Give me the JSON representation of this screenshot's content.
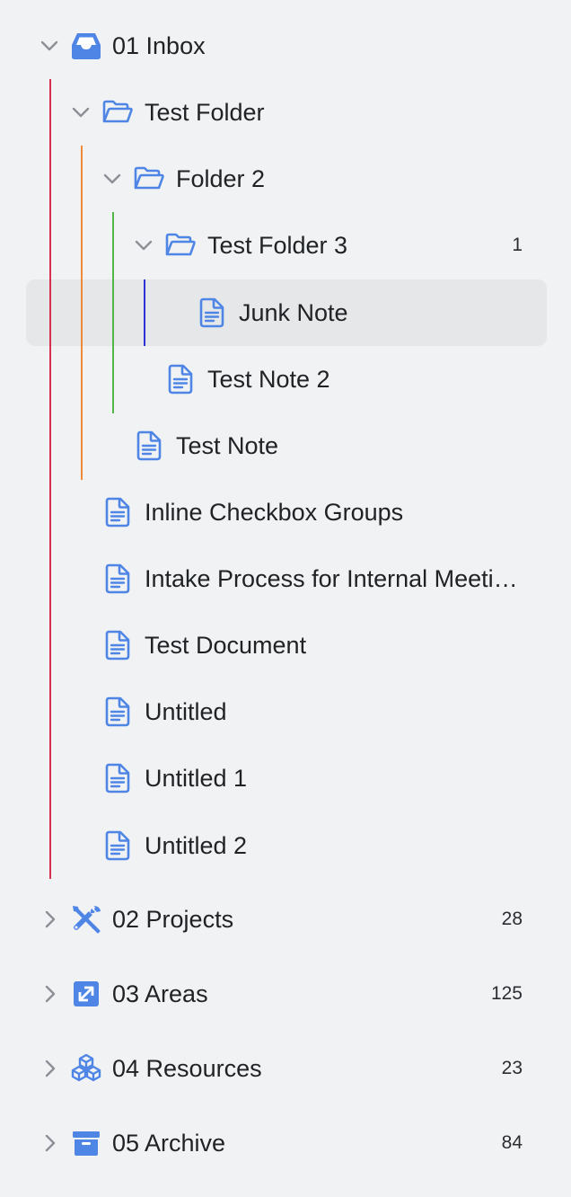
{
  "colors": {
    "icon_blue": "#4f86e6",
    "guide_level1": "#d8304e",
    "guide_level2": "#ee8a3a",
    "guide_level3": "#55b44a",
    "guide_level4": "#2d33d6",
    "selected_bg": "#e6e7e9",
    "background": "#f1f2f4"
  },
  "tree": {
    "inbox": {
      "label": "01 Inbox",
      "icon": "inbox-icon",
      "expanded": true
    },
    "test_folder": {
      "label": "Test Folder",
      "icon": "folder-open-icon",
      "expanded": true
    },
    "folder_2": {
      "label": "Folder 2",
      "icon": "folder-open-icon",
      "expanded": true
    },
    "test_folder_3": {
      "label": "Test Folder 3",
      "icon": "folder-open-icon",
      "expanded": true,
      "count": "1"
    },
    "junk_note": {
      "label": "Junk Note",
      "icon": "document-icon",
      "selected": true
    },
    "test_note_2": {
      "label": "Test Note 2",
      "icon": "document-icon"
    },
    "test_note": {
      "label": "Test Note",
      "icon": "document-icon"
    },
    "inline_checkbox_groups": {
      "label": "Inline Checkbox Groups",
      "icon": "document-icon"
    },
    "intake_process": {
      "label": "Intake Process for Internal Meeti…",
      "icon": "document-icon"
    },
    "test_document": {
      "label": "Test Document",
      "icon": "document-icon"
    },
    "untitled": {
      "label": "Untitled",
      "icon": "document-icon"
    },
    "untitled_1": {
      "label": "Untitled 1",
      "icon": "document-icon"
    },
    "untitled_2": {
      "label": "Untitled 2",
      "icon": "document-icon"
    },
    "projects": {
      "label": "02 Projects",
      "icon": "tools-icon",
      "expanded": false,
      "count": "28"
    },
    "areas": {
      "label": "03 Areas",
      "icon": "areas-icon",
      "expanded": false,
      "count": "125"
    },
    "resources": {
      "label": "04 Resources",
      "icon": "cubes-icon",
      "expanded": false,
      "count": "23"
    },
    "archive": {
      "label": "05 Archive",
      "icon": "archive-box-icon",
      "expanded": false,
      "count": "84"
    }
  }
}
